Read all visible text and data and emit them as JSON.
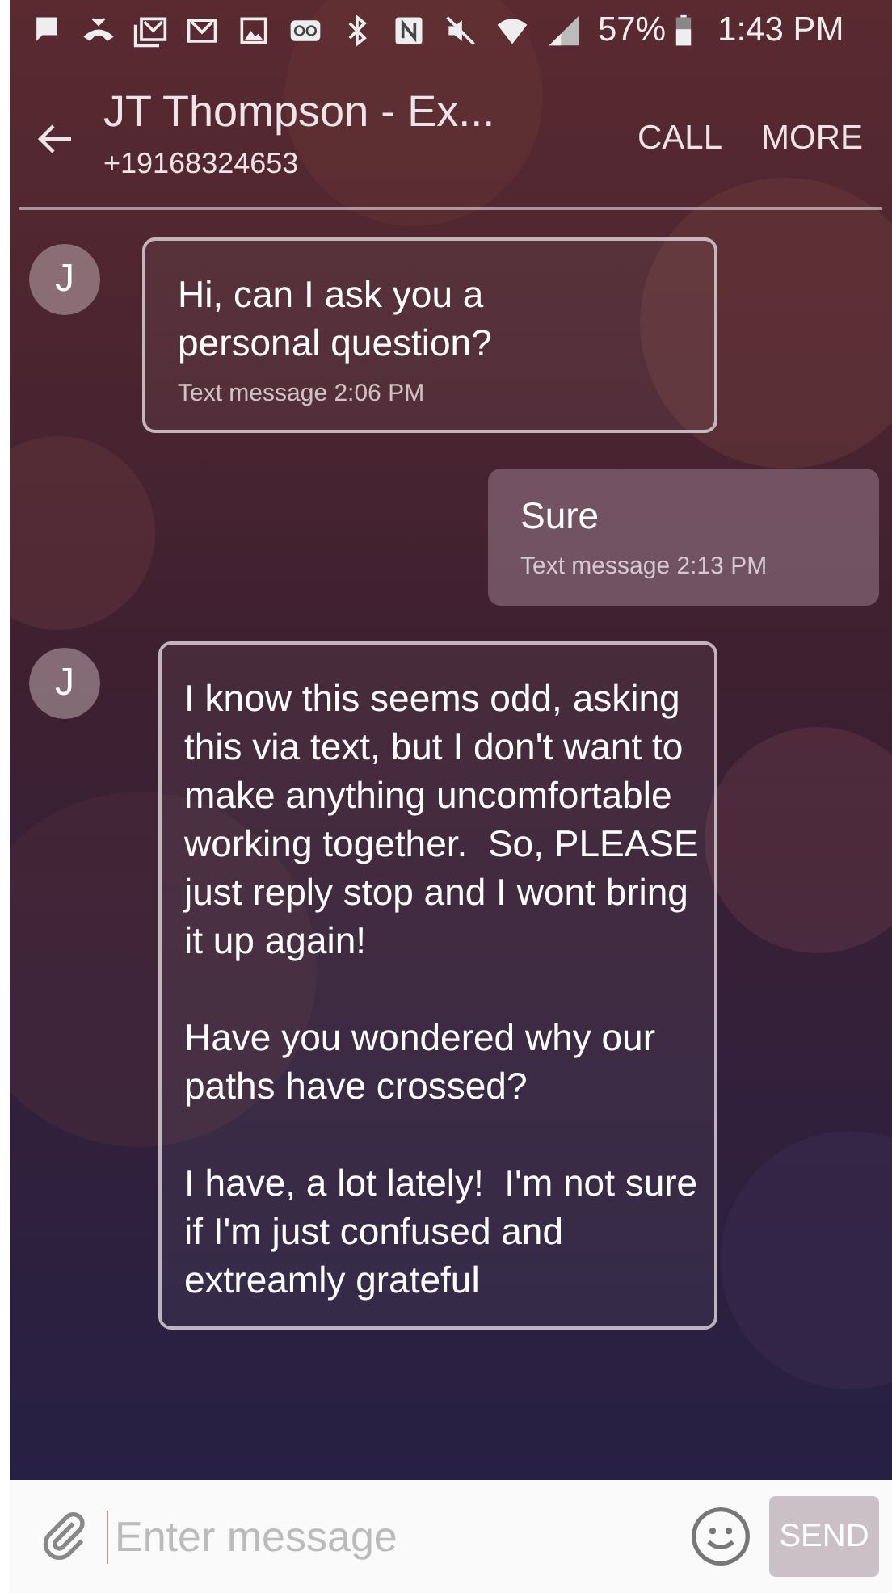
{
  "status_bar": {
    "battery": "57%",
    "time": "1:43 PM"
  },
  "header": {
    "title": "JT Thompson - Ex...",
    "subtitle": "+19168324653",
    "actions": [
      "CALL",
      "MORE"
    ]
  },
  "messages": [
    {
      "kind": "incoming",
      "avatar": "J",
      "paragraphs": [
        "Hi, can I ask you a personal question?"
      ],
      "meta": "Text message 2:06 PM"
    },
    {
      "kind": "outgoing",
      "paragraphs": [
        "Sure"
      ],
      "meta": "Text message 2:13 PM"
    },
    {
      "kind": "incoming",
      "avatar": "J",
      "paragraphs": [
        "I know this seems odd, asking this via text, but I don't want to make anything uncomfortable working together.  So, PLEASE just reply stop and I wont bring it up again!",
        "Have you wondered why our paths have crossed?",
        "I have, a lot lately!  I'm not sure if I'm just confused and extreamly grateful"
      ]
    }
  ],
  "composer": {
    "placeholder": "Enter message",
    "send": "SEND",
    "send_disabled": true
  }
}
